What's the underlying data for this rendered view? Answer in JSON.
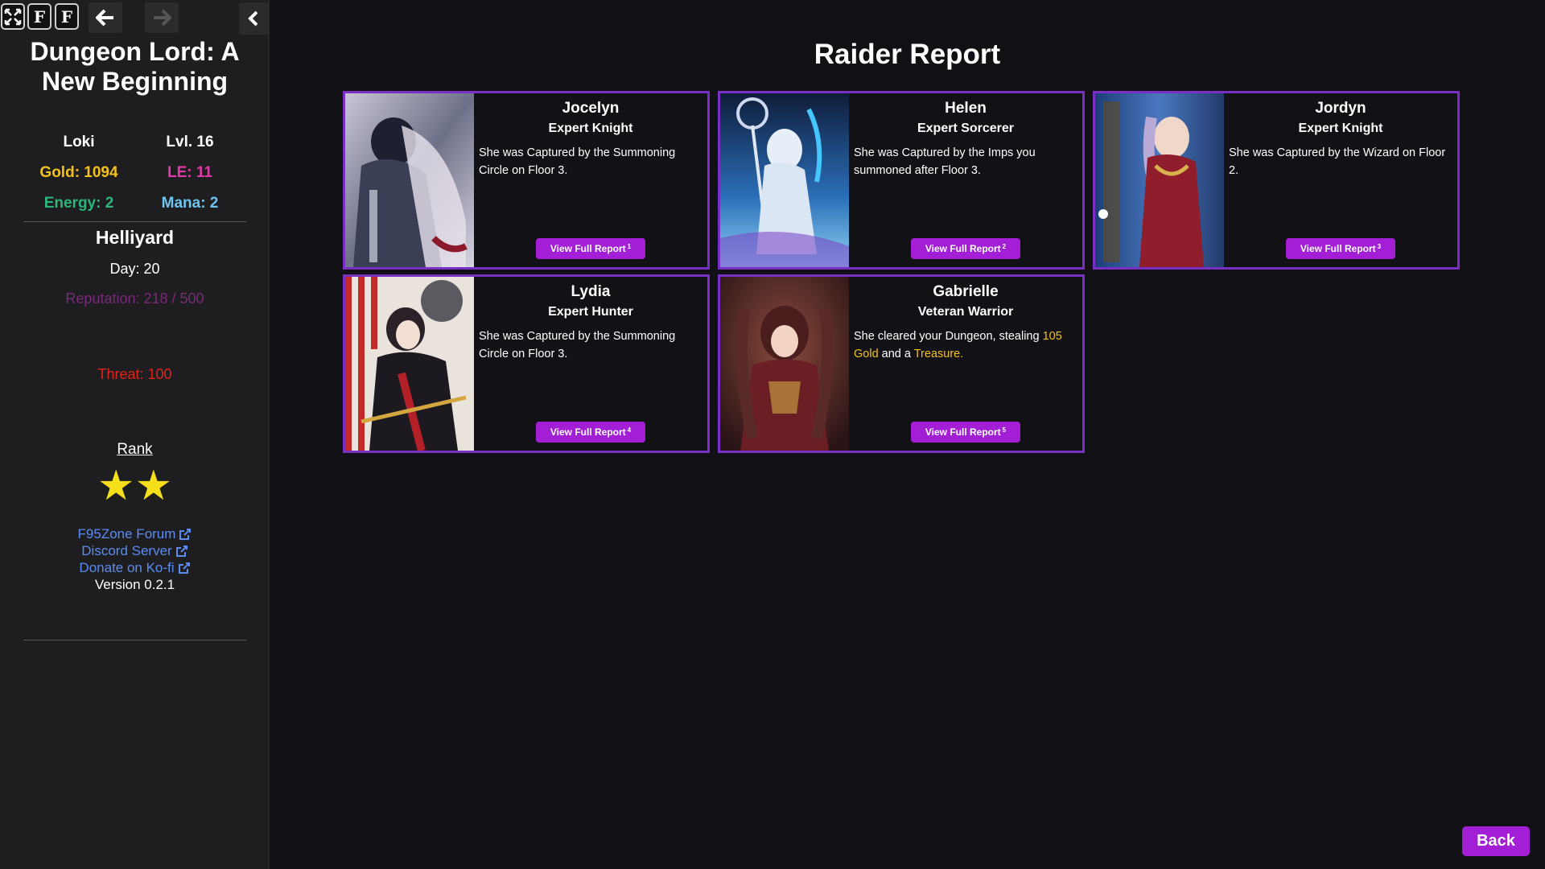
{
  "sidebar": {
    "game_title_line1": "Dungeon Lord: A",
    "game_title_line2": "New Beginning",
    "player_name": "Loki",
    "level": "Lvl. 16",
    "gold": "Gold: 1094",
    "le": "LE: 11",
    "energy": "Energy: 2",
    "mana": "Mana: 2",
    "dungeon_name": "Helliyard",
    "day": "Day: 20",
    "reputation": "Reputation: 218 / 500",
    "threat": "Threat: 100",
    "rank_label": "Rank",
    "rank_stars": "★★",
    "links": [
      "F95Zone Forum",
      "Discord Server",
      "Donate on Ko-fi"
    ],
    "version": "Version 0.2.1",
    "colors": {
      "gold": "#f3c11d",
      "le": "#e33aa7",
      "energy": "#2eb57a",
      "mana": "#6cc4f2",
      "reputation": "#7a2a78",
      "threat": "#e0241a",
      "link": "#5b8cf2"
    }
  },
  "toolbar": {
    "icons": [
      "fullscreen-icon",
      "font-icon",
      "font-small-icon",
      "arrow-left-icon",
      "arrow-right-icon",
      "chevron-left-icon"
    ]
  },
  "main": {
    "title": "Raider Report",
    "back_label": "Back",
    "raiders": [
      {
        "name": "Jocelyn",
        "class": "Expert Knight",
        "desc": "She was Captured by the Summoning Circle on Floor 3.",
        "button": "View Full Report",
        "num": "1"
      },
      {
        "name": "Helen",
        "class": "Expert Sorcerer",
        "desc": "She was Captured by the Imps you summoned after Floor 3.",
        "button": "View Full Report",
        "num": "2"
      },
      {
        "name": "Jordyn",
        "class": "Expert Knight",
        "desc": "She was Captured by the Wizard on Floor 2.",
        "button": "View Full Report",
        "num": "3"
      },
      {
        "name": "Lydia",
        "class": "Expert Hunter",
        "desc": "She was Captured by the Summoning Circle on Floor 3.",
        "button": "View Full Report",
        "num": "4"
      },
      {
        "name": "Gabrielle",
        "class": "Veteran Warrior",
        "desc_parts": [
          "She cleared your Dungeon, stealing ",
          "105 Gold",
          " and a ",
          "Treasure."
        ],
        "button": "View Full Report",
        "num": "5"
      }
    ],
    "accent": "#a21fd6",
    "card_border": "#7a2fc4"
  }
}
